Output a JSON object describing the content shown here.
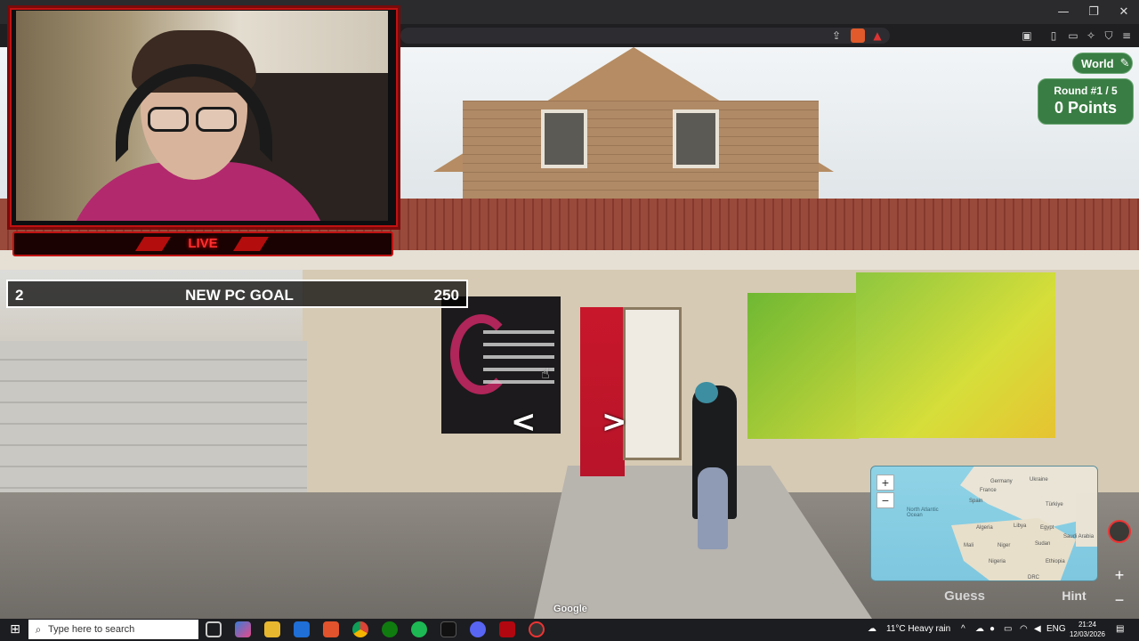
{
  "window": {
    "minimize": "—",
    "restore": "❐",
    "close": "✕"
  },
  "stream": {
    "live_label": "LIVE",
    "goal": {
      "count": "2",
      "label": "NEW PC GOAL",
      "target": "250"
    }
  },
  "game": {
    "map_name": "World",
    "round_label": "Round #1 / 5",
    "points_label": "0 Points",
    "guess_label": "Guess",
    "hint_label": "Hint",
    "map_labels": [
      "Germany",
      "Ukraine",
      "France",
      "Spain",
      "Türkiye",
      "North Atlantic Ocean",
      "Algeria",
      "Libya",
      "Egypt",
      "Mali",
      "Niger",
      "Sudan",
      "Saudi Arabia",
      "Nigeria",
      "Ethiopia",
      "DRC"
    ],
    "attribution": "Google",
    "nav_left": "<",
    "nav_right": ">"
  },
  "taskbar": {
    "search_placeholder": "Type here to search",
    "weather": "11°C  Heavy rain",
    "language": "ENG",
    "time": "21:24",
    "date": "12/03/2026"
  },
  "colors": {
    "accent_green": "#3a7d44",
    "stream_red": "#c01212"
  }
}
